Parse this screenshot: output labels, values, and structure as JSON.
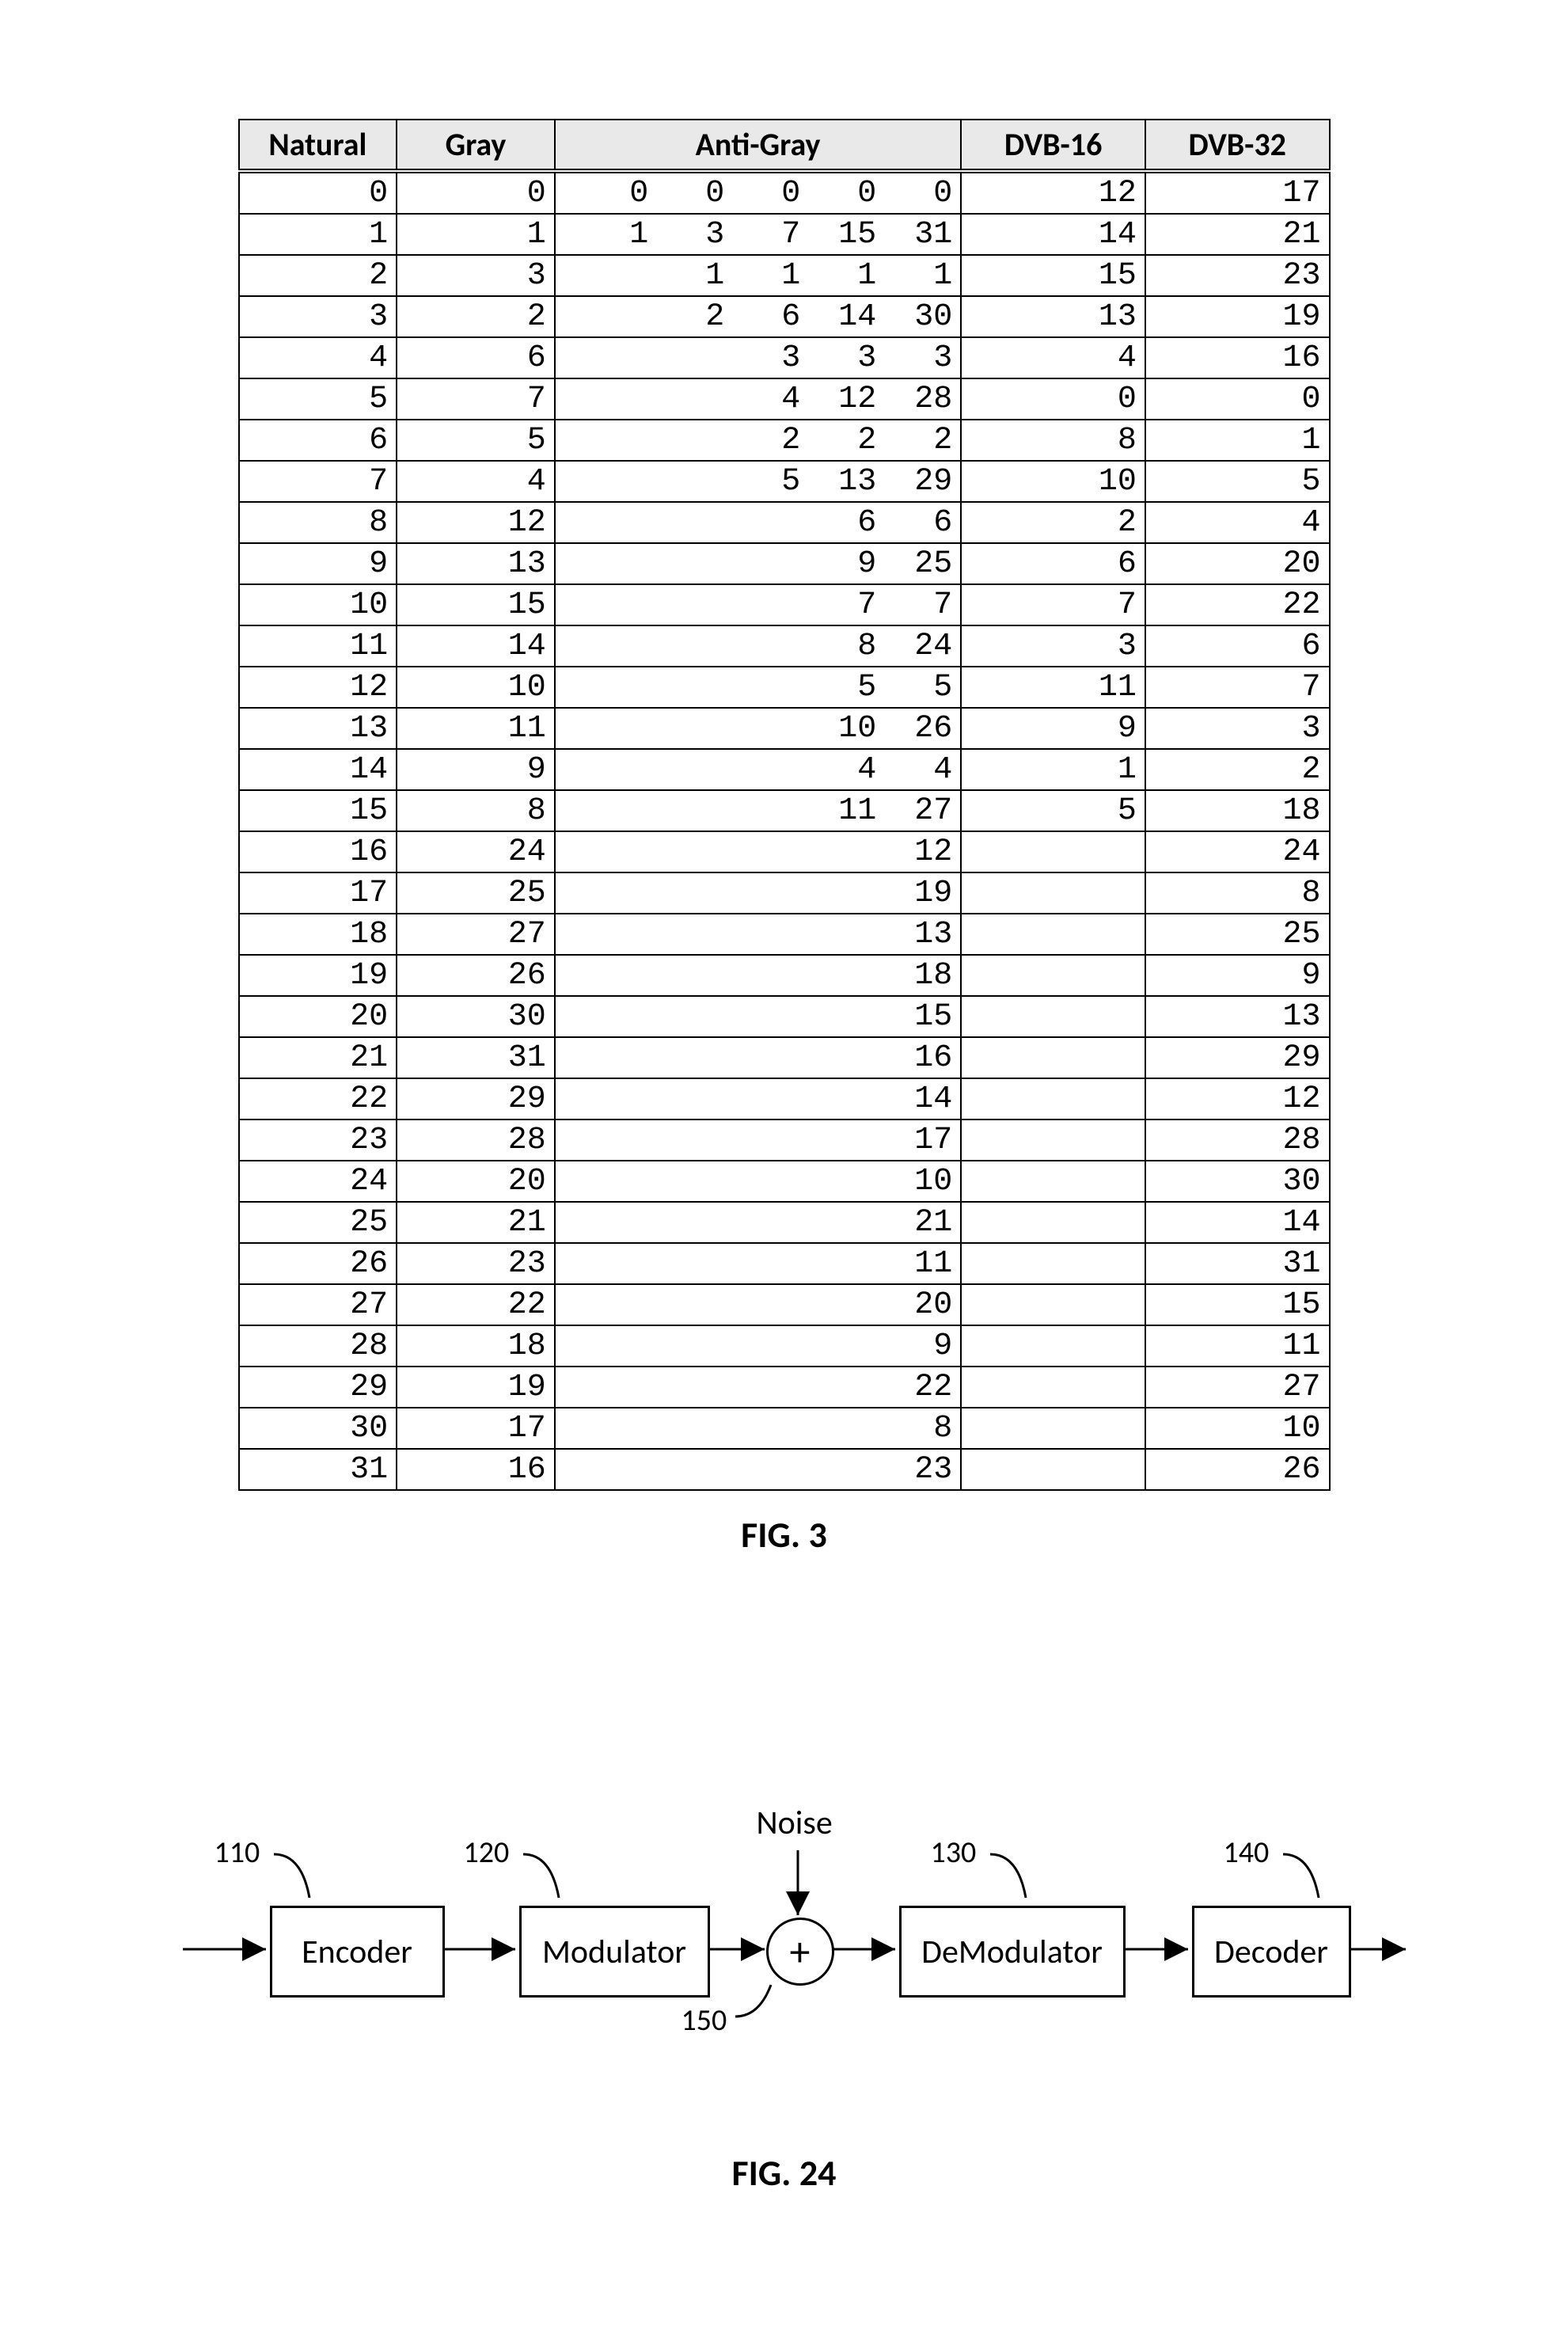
{
  "chart_data": {
    "type": "table",
    "headers": [
      "Natural",
      "Gray",
      "Anti-Gray",
      "DVB-16",
      "DVB-32"
    ],
    "rows": [
      {
        "natural": "0",
        "gray": "0",
        "anti_gray": [
          "0",
          "0",
          "0",
          "0",
          "0"
        ],
        "dvb16": "12",
        "dvb32": "17"
      },
      {
        "natural": "1",
        "gray": "1",
        "anti_gray": [
          "1",
          "3",
          "7",
          "15",
          "31"
        ],
        "dvb16": "14",
        "dvb32": "21"
      },
      {
        "natural": "2",
        "gray": "3",
        "anti_gray": [
          "",
          "1",
          "1",
          "1",
          "1"
        ],
        "dvb16": "15",
        "dvb32": "23"
      },
      {
        "natural": "3",
        "gray": "2",
        "anti_gray": [
          "",
          "2",
          "6",
          "14",
          "30"
        ],
        "dvb16": "13",
        "dvb32": "19"
      },
      {
        "natural": "4",
        "gray": "6",
        "anti_gray": [
          "",
          "",
          "3",
          "3",
          "3"
        ],
        "dvb16": "4",
        "dvb32": "16"
      },
      {
        "natural": "5",
        "gray": "7",
        "anti_gray": [
          "",
          "",
          "4",
          "12",
          "28"
        ],
        "dvb16": "0",
        "dvb32": "0"
      },
      {
        "natural": "6",
        "gray": "5",
        "anti_gray": [
          "",
          "",
          "2",
          "2",
          "2"
        ],
        "dvb16": "8",
        "dvb32": "1"
      },
      {
        "natural": "7",
        "gray": "4",
        "anti_gray": [
          "",
          "",
          "5",
          "13",
          "29"
        ],
        "dvb16": "10",
        "dvb32": "5"
      },
      {
        "natural": "8",
        "gray": "12",
        "anti_gray": [
          "",
          "",
          "",
          "6",
          "6"
        ],
        "dvb16": "2",
        "dvb32": "4"
      },
      {
        "natural": "9",
        "gray": "13",
        "anti_gray": [
          "",
          "",
          "",
          "9",
          "25"
        ],
        "dvb16": "6",
        "dvb32": "20"
      },
      {
        "natural": "10",
        "gray": "15",
        "anti_gray": [
          "",
          "",
          "",
          "7",
          "7"
        ],
        "dvb16": "7",
        "dvb32": "22"
      },
      {
        "natural": "11",
        "gray": "14",
        "anti_gray": [
          "",
          "",
          "",
          "8",
          "24"
        ],
        "dvb16": "3",
        "dvb32": "6"
      },
      {
        "natural": "12",
        "gray": "10",
        "anti_gray": [
          "",
          "",
          "",
          "5",
          "5"
        ],
        "dvb16": "11",
        "dvb32": "7"
      },
      {
        "natural": "13",
        "gray": "11",
        "anti_gray": [
          "",
          "",
          "",
          "10",
          "26"
        ],
        "dvb16": "9",
        "dvb32": "3"
      },
      {
        "natural": "14",
        "gray": "9",
        "anti_gray": [
          "",
          "",
          "",
          "4",
          "4"
        ],
        "dvb16": "1",
        "dvb32": "2"
      },
      {
        "natural": "15",
        "gray": "8",
        "anti_gray": [
          "",
          "",
          "",
          "11",
          "27"
        ],
        "dvb16": "5",
        "dvb32": "18"
      },
      {
        "natural": "16",
        "gray": "24",
        "anti_gray": [
          "",
          "",
          "",
          "",
          "12"
        ],
        "dvb16": "",
        "dvb32": "24"
      },
      {
        "natural": "17",
        "gray": "25",
        "anti_gray": [
          "",
          "",
          "",
          "",
          "19"
        ],
        "dvb16": "",
        "dvb32": "8"
      },
      {
        "natural": "18",
        "gray": "27",
        "anti_gray": [
          "",
          "",
          "",
          "",
          "13"
        ],
        "dvb16": "",
        "dvb32": "25"
      },
      {
        "natural": "19",
        "gray": "26",
        "anti_gray": [
          "",
          "",
          "",
          "",
          "18"
        ],
        "dvb16": "",
        "dvb32": "9"
      },
      {
        "natural": "20",
        "gray": "30",
        "anti_gray": [
          "",
          "",
          "",
          "",
          "15"
        ],
        "dvb16": "",
        "dvb32": "13"
      },
      {
        "natural": "21",
        "gray": "31",
        "anti_gray": [
          "",
          "",
          "",
          "",
          "16"
        ],
        "dvb16": "",
        "dvb32": "29"
      },
      {
        "natural": "22",
        "gray": "29",
        "anti_gray": [
          "",
          "",
          "",
          "",
          "14"
        ],
        "dvb16": "",
        "dvb32": "12"
      },
      {
        "natural": "23",
        "gray": "28",
        "anti_gray": [
          "",
          "",
          "",
          "",
          "17"
        ],
        "dvb16": "",
        "dvb32": "28"
      },
      {
        "natural": "24",
        "gray": "20",
        "anti_gray": [
          "",
          "",
          "",
          "",
          "10"
        ],
        "dvb16": "",
        "dvb32": "30"
      },
      {
        "natural": "25",
        "gray": "21",
        "anti_gray": [
          "",
          "",
          "",
          "",
          "21"
        ],
        "dvb16": "",
        "dvb32": "14"
      },
      {
        "natural": "26",
        "gray": "23",
        "anti_gray": [
          "",
          "",
          "",
          "",
          "11"
        ],
        "dvb16": "",
        "dvb32": "31"
      },
      {
        "natural": "27",
        "gray": "22",
        "anti_gray": [
          "",
          "",
          "",
          "",
          "20"
        ],
        "dvb16": "",
        "dvb32": "15"
      },
      {
        "natural": "28",
        "gray": "18",
        "anti_gray": [
          "",
          "",
          "",
          "",
          "9"
        ],
        "dvb16": "",
        "dvb32": "11"
      },
      {
        "natural": "29",
        "gray": "19",
        "anti_gray": [
          "",
          "",
          "",
          "",
          "22"
        ],
        "dvb16": "",
        "dvb32": "27"
      },
      {
        "natural": "30",
        "gray": "17",
        "anti_gray": [
          "",
          "",
          "",
          "",
          "8"
        ],
        "dvb16": "",
        "dvb32": "10"
      },
      {
        "natural": "31",
        "gray": "16",
        "anti_gray": [
          "",
          "",
          "",
          "",
          "23"
        ],
        "dvb16": "",
        "dvb32": "26"
      }
    ]
  },
  "captions": {
    "fig3": "FIG. 3",
    "fig24": "FIG. 24"
  },
  "diagram": {
    "noise_label": "Noise",
    "plus_label": "+",
    "blocks": {
      "encoder": {
        "label": "Encoder",
        "num": "110"
      },
      "modulator": {
        "label": "Modulator",
        "num": "120"
      },
      "adder": {
        "num": "150"
      },
      "demodulator": {
        "label": "DeModulator",
        "num": "130"
      },
      "decoder": {
        "label": "Decoder",
        "num": "140"
      }
    }
  }
}
